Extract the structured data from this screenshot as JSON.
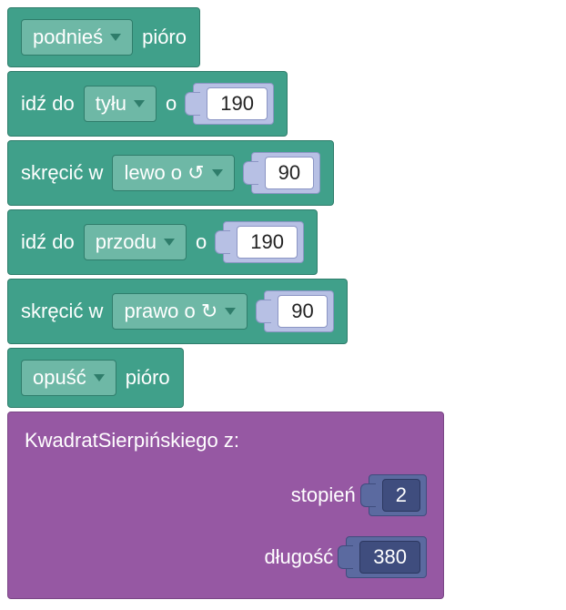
{
  "blocks": {
    "pen_up": {
      "dropdown": "podnieś",
      "suffix": "pióro"
    },
    "move_back": {
      "prefix": "idź do",
      "dropdown": "tyłu",
      "suffix": "o",
      "value": "190"
    },
    "turn_left": {
      "prefix": "skręcić w",
      "dropdown": "lewo o ↺",
      "value": "90"
    },
    "move_fwd": {
      "prefix": "idź do",
      "dropdown": "przodu",
      "suffix": "o",
      "value": "190"
    },
    "turn_right": {
      "prefix": "skręcić w",
      "dropdown": "prawo o ↻",
      "value": "90"
    },
    "pen_down": {
      "dropdown": "opuść",
      "suffix": "pióro"
    },
    "call": {
      "title": "KwadratSierpińskiego  z:",
      "params": [
        {
          "label": "stopień",
          "value": "2"
        },
        {
          "label": "długość",
          "value": "380"
        }
      ]
    }
  }
}
